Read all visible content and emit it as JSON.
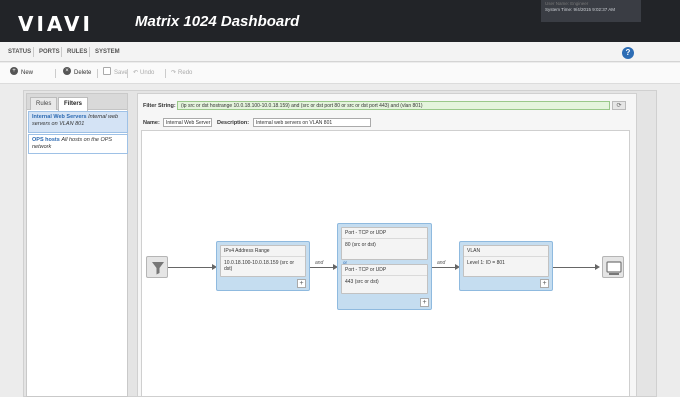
{
  "header": {
    "logo": "VIAVI",
    "title": "Matrix 1024 Dashboard",
    "user_label": "User Name: Engineer",
    "system_time": "System Time: 9/4/2015 9:02:37 AM"
  },
  "menu": {
    "items": [
      "STATUS",
      "PORTS",
      "RULES",
      "SYSTEM"
    ]
  },
  "toolbar": {
    "new": "New",
    "delete": "Delete",
    "save": "Save",
    "undo": "Undo",
    "redo": "Redo"
  },
  "left_panel": {
    "tabs": [
      "Rules",
      "Filters"
    ],
    "active_tab": "Filters",
    "filters": [
      {
        "name": "Internal Web Servers",
        "description": "Internal web servers on VLAN 801"
      },
      {
        "name": "OPS hosts",
        "description": "All hosts on the OPS network"
      }
    ]
  },
  "filter_editor": {
    "filter_string_label": "Filter String:",
    "filter_string": "(ip src or dst hostrange 10.0.18.100-10.0.18.159) and (src or dst port 80 or src or dst port 443) and (vlan 801)",
    "name_label": "Name:",
    "name_value": "Internal Web Server",
    "description_label": "Description:",
    "description_value": "Internal web servers on VLAN 801"
  },
  "diagram": {
    "and_label": "and",
    "or_label": "or",
    "blocks": [
      {
        "title": "IPv4 Address Range",
        "value": "10.0.18.100-10.0.18.159 (src or dst)"
      },
      {
        "title": "Port - TCP or UDP",
        "value": "80 (src or dst)"
      },
      {
        "title": "Port - TCP or UDP",
        "value": "443 (src or dst)"
      },
      {
        "title": "VLAN",
        "value": "Level 1: ID = 801"
      }
    ]
  },
  "colors": {
    "header_bg": "#222428",
    "filter_string_bg": "#e4f4dc",
    "block_bg": "#c5ddf0",
    "link_blue": "#2b69b1"
  }
}
